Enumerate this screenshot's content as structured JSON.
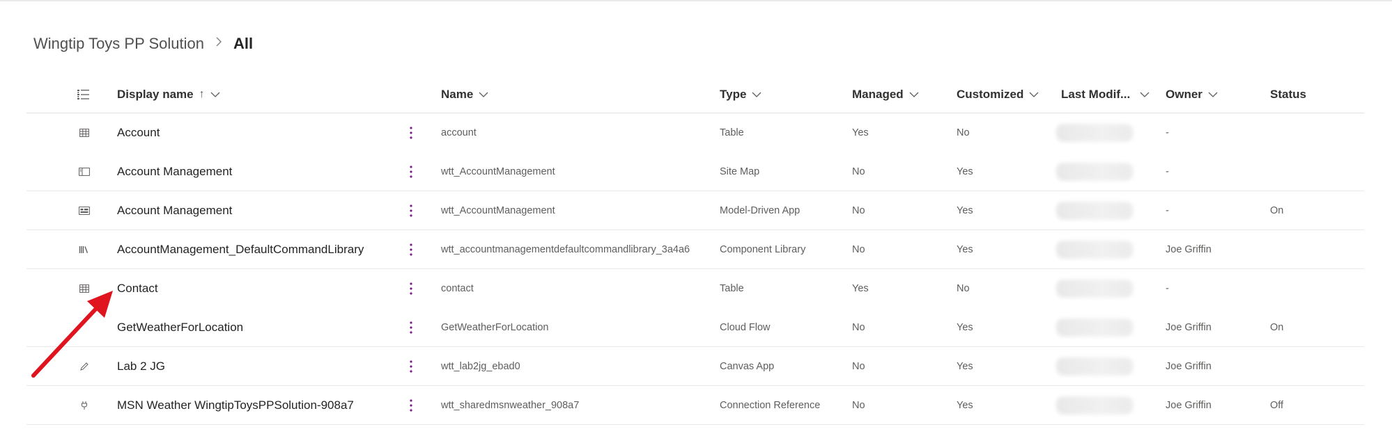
{
  "breadcrumb": {
    "parent": "Wingtip Toys PP Solution",
    "separator": ">",
    "current": "All"
  },
  "columns": {
    "display_name": "Display name",
    "sort_indicator": "↑",
    "name": "Name",
    "type": "Type",
    "managed": "Managed",
    "customized": "Customized",
    "last_modified": "Last Modif...",
    "owner": "Owner",
    "status": "Status"
  },
  "rows": [
    {
      "icon": "table-icon",
      "display": "Account",
      "name": "account",
      "type": "Table",
      "managed": "Yes",
      "customized": "No",
      "owner": "-",
      "status": ""
    },
    {
      "icon": "sitemap-icon",
      "display": "Account Management",
      "name": "wtt_AccountManagement",
      "type": "Site Map",
      "managed": "No",
      "customized": "Yes",
      "owner": "-",
      "status": ""
    },
    {
      "icon": "app-icon",
      "display": "Account Management",
      "name": "wtt_AccountManagement",
      "type": "Model-Driven App",
      "managed": "No",
      "customized": "Yes",
      "owner": "-",
      "status": "On"
    },
    {
      "icon": "library-icon",
      "display": "AccountManagement_DefaultCommandLibrary",
      "name": "wtt_accountmanagementdefaultcommandlibrary_3a4a6",
      "type": "Component Library",
      "managed": "No",
      "customized": "Yes",
      "owner": "Joe Griffin",
      "status": ""
    },
    {
      "icon": "table-icon",
      "display": "Contact",
      "name": "contact",
      "type": "Table",
      "managed": "Yes",
      "customized": "No",
      "owner": "-",
      "status": ""
    },
    {
      "icon": "",
      "display": "GetWeatherForLocation",
      "name": "GetWeatherForLocation",
      "type": "Cloud Flow",
      "managed": "No",
      "customized": "Yes",
      "owner": "Joe Griffin",
      "status": "On"
    },
    {
      "icon": "pencil-icon",
      "display": "Lab 2 JG",
      "name": "wtt_lab2jg_ebad0",
      "type": "Canvas App",
      "managed": "No",
      "customized": "Yes",
      "owner": "Joe Griffin",
      "status": ""
    },
    {
      "icon": "plug-icon",
      "display": "MSN Weather WingtipToysPPSolution-908a7",
      "name": "wtt_sharedmsnweather_908a7",
      "type": "Connection Reference",
      "managed": "No",
      "customized": "Yes",
      "owner": "Joe Griffin",
      "status": "Off"
    }
  ],
  "colors": {
    "accent_arrow": "#e0141e",
    "more_dots": "#7a1f8a",
    "divider": "#edebe9"
  }
}
